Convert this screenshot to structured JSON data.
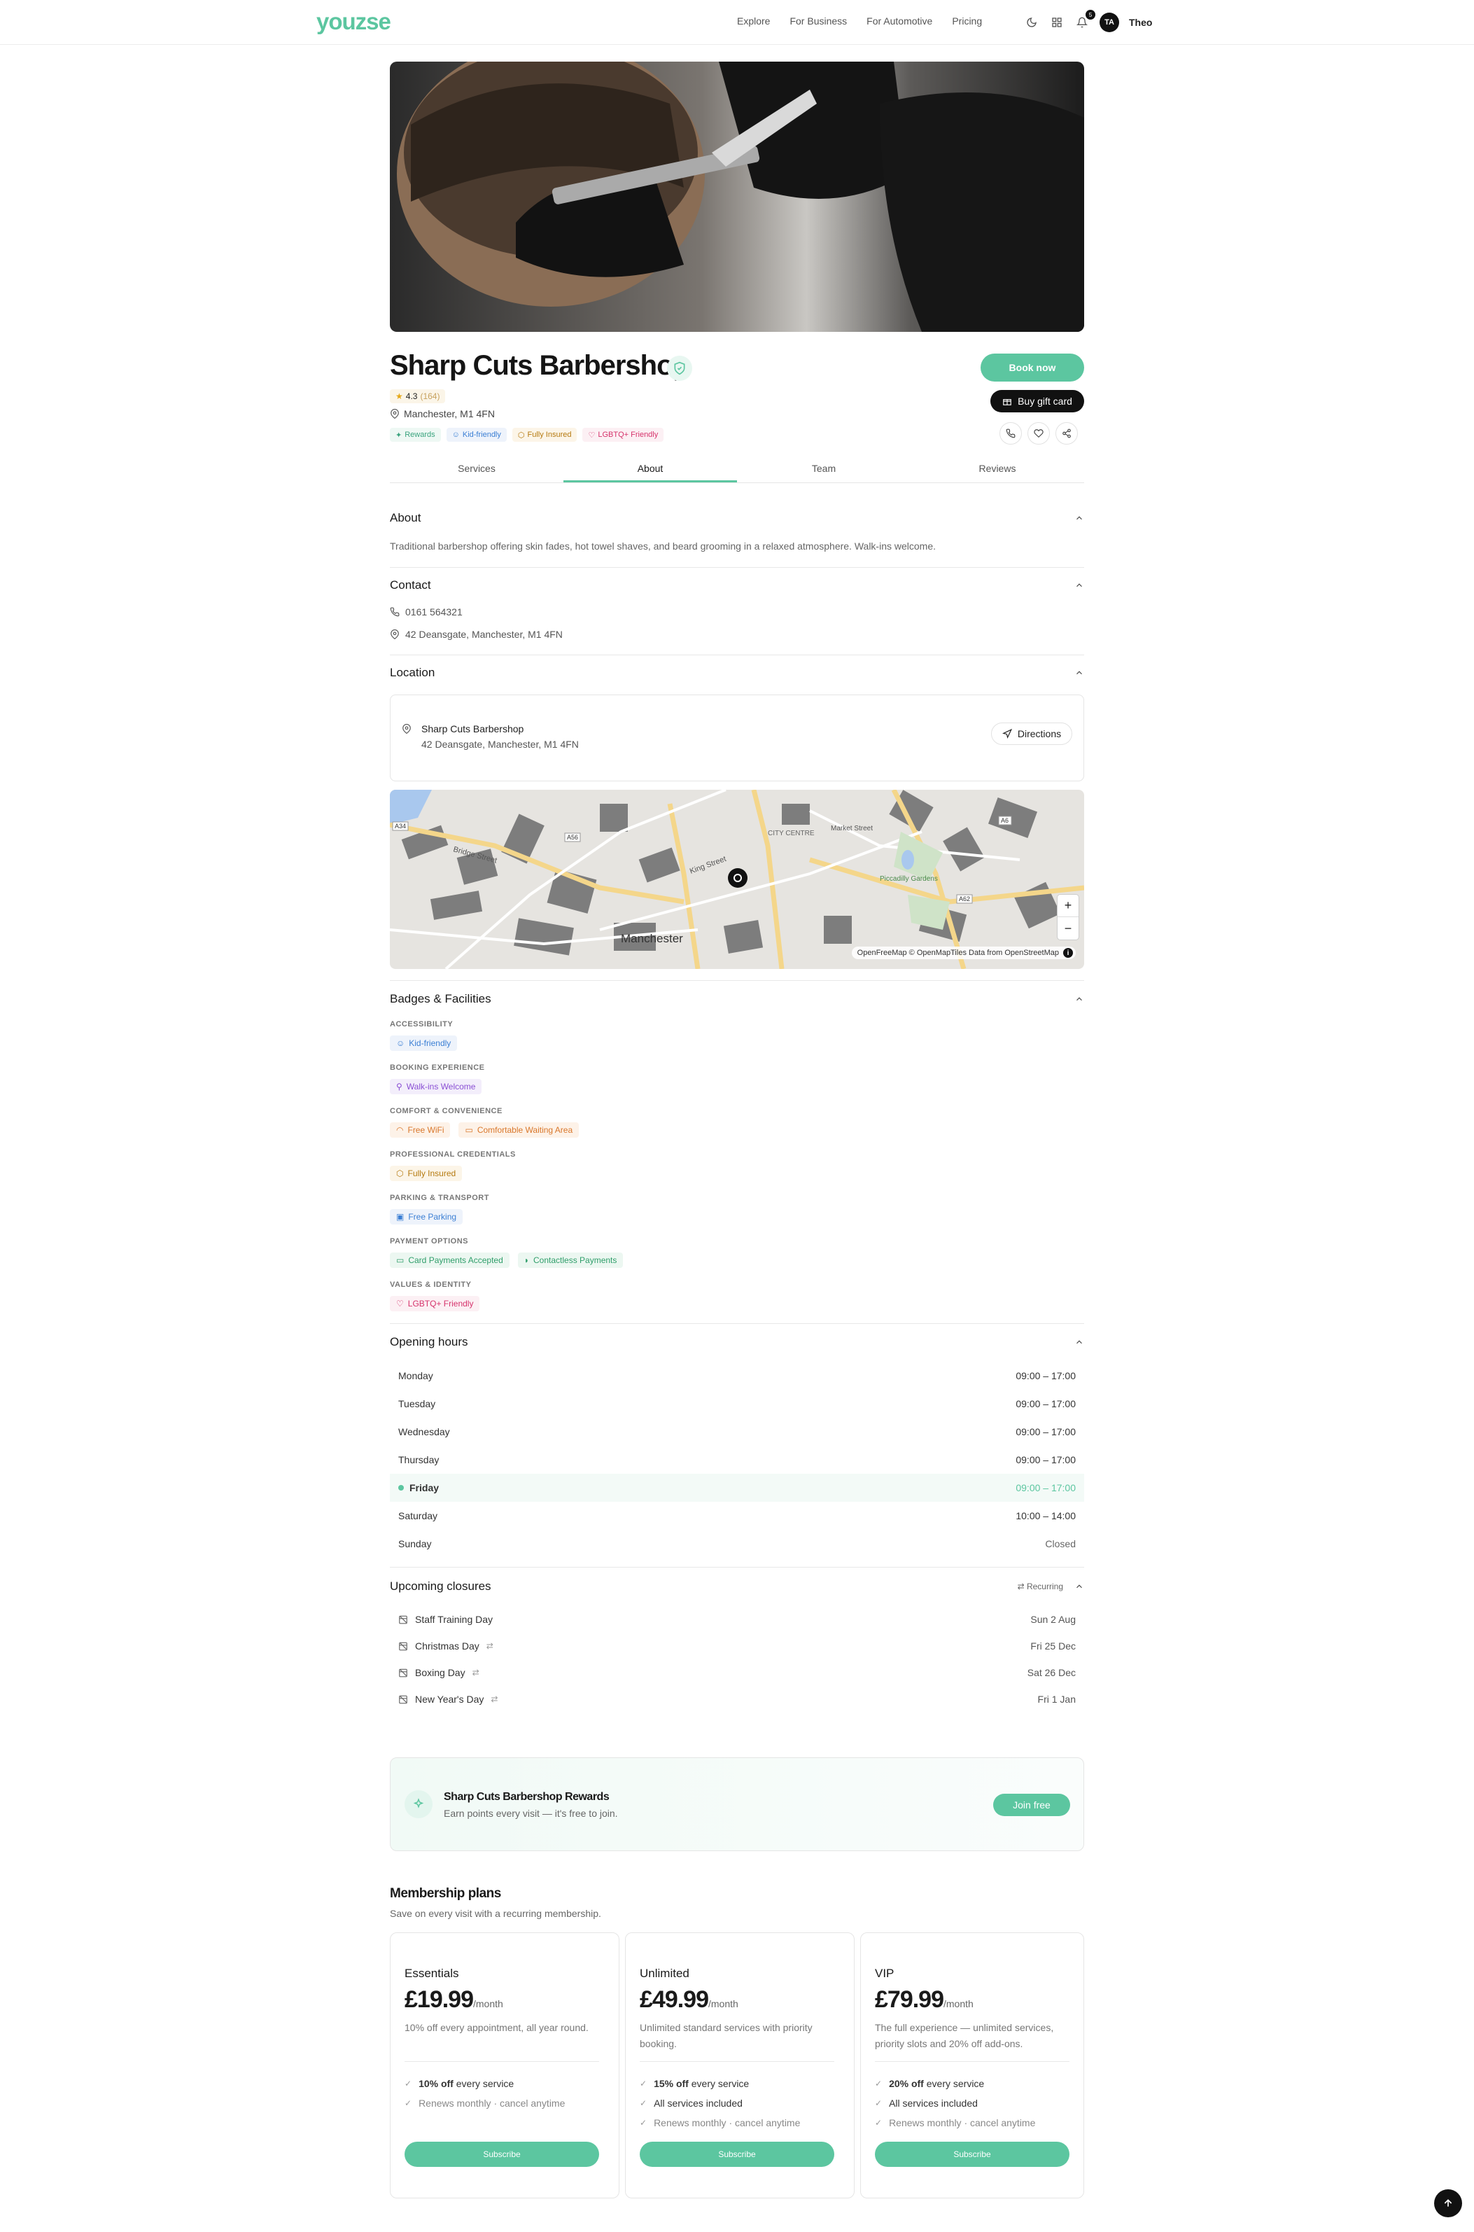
{
  "nav": {
    "logo": "youzse",
    "links": [
      "Explore",
      "For Business",
      "For Automotive",
      "Pricing"
    ],
    "notification_count": "5",
    "avatar_initials": "TA",
    "user_name": "Theo"
  },
  "business": {
    "name": "Sharp Cuts Barbershop",
    "rating": "4.3",
    "review_count": "(164)",
    "location": "Manchester, M1 4FN",
    "chips": [
      {
        "label": "Rewards",
        "color": "#5cc6a0"
      },
      {
        "label": "Kid-friendly",
        "color": "#3b7fd4"
      },
      {
        "label": "Fully Insured",
        "color": "#c98a1b"
      },
      {
        "label": "LGBTQ+ Friendly",
        "color": "#d6336c"
      }
    ]
  },
  "actions": {
    "book": "Book now",
    "gift": "Buy gift card"
  },
  "tabs": [
    "Services",
    "About",
    "Team",
    "Reviews"
  ],
  "active_tab": "About",
  "about": {
    "title": "About",
    "text": "Traditional barbershop offering skin fades, hot towel shaves, and beard grooming in a relaxed atmosphere. Walk-ins welcome."
  },
  "contact": {
    "title": "Contact",
    "phone": "0161 564321",
    "address": "42 Deansgate, Manchester, M1 4FN"
  },
  "location": {
    "title": "Location",
    "name": "Sharp Cuts Barbershop",
    "address": "42 Deansgate, Manchester, M1 4FN",
    "directions": "Directions",
    "map_labels": [
      "Manchester",
      "CITY CENTRE",
      "Piccadilly Gardens",
      "Market Street",
      "King Street",
      "Bridge Street",
      "A34",
      "A56",
      "A62",
      "A6"
    ],
    "attribution": "OpenFreeMap © OpenMapTiles Data from OpenStreetMap",
    "zoom_in": "+",
    "zoom_out": "−"
  },
  "badges": {
    "title": "Badges & Facilities",
    "groups": [
      {
        "label": "ACCESSIBILITY",
        "items": [
          {
            "name": "Kid-friendly",
            "color": "#3b7fd4"
          }
        ]
      },
      {
        "label": "BOOKING EXPERIENCE",
        "items": [
          {
            "name": "Walk-ins Welcome",
            "color": "#8a4fd4"
          }
        ]
      },
      {
        "label": "COMFORT & CONVENIENCE",
        "items": [
          {
            "name": "Free WiFi",
            "color": "#d9772b"
          },
          {
            "name": "Comfortable Waiting Area",
            "color": "#d9772b"
          }
        ]
      },
      {
        "label": "PROFESSIONAL CREDENTIALS",
        "items": [
          {
            "name": "Fully Insured",
            "color": "#c98a1b"
          }
        ]
      },
      {
        "label": "PARKING & TRANSPORT",
        "items": [
          {
            "name": "Free Parking",
            "color": "#3b7fd4"
          }
        ]
      },
      {
        "label": "PAYMENT OPTIONS",
        "items": [
          {
            "name": "Card Payments Accepted",
            "color": "#2f9e6a"
          },
          {
            "name": "Contactless Payments",
            "color": "#2f9e6a"
          }
        ]
      },
      {
        "label": "VALUES & IDENTITY",
        "items": [
          {
            "name": "LGBTQ+ Friendly",
            "color": "#d6336c"
          }
        ]
      }
    ]
  },
  "hours": {
    "title": "Opening hours",
    "days": [
      {
        "day": "Monday",
        "time": "09:00 – 17:00"
      },
      {
        "day": "Tuesday",
        "time": "09:00 – 17:00"
      },
      {
        "day": "Wednesday",
        "time": "09:00 – 17:00"
      },
      {
        "day": "Thursday",
        "time": "09:00 – 17:00"
      },
      {
        "day": "Friday",
        "time": "09:00 – 17:00"
      },
      {
        "day": "Saturday",
        "time": "10:00 – 14:00"
      },
      {
        "day": "Sunday",
        "time": "Closed"
      }
    ]
  },
  "closures": {
    "title": "Upcoming closures",
    "recurring_label": "Recurring",
    "items": [
      {
        "name": "Staff Training Day",
        "date": "Sun 2 Aug",
        "recurring": false
      },
      {
        "name": "Christmas Day",
        "date": "Fri 25 Dec",
        "recurring": true
      },
      {
        "name": "Boxing Day",
        "date": "Sat 26 Dec",
        "recurring": true
      },
      {
        "name": "New Year's Day",
        "date": "Fri 1 Jan",
        "recurring": true
      }
    ]
  },
  "rewards": {
    "title": "Sharp Cuts Barbershop Rewards",
    "subtitle": "Earn points every visit — it's free to join.",
    "button": "Join free"
  },
  "membership": {
    "title": "Membership plans",
    "subtitle": "Save on every visit with a recurring membership.",
    "plans": [
      {
        "name": "Essentials",
        "price": "£19.99",
        "period": "/month",
        "desc": "10% off every appointment, all year round.",
        "features": [
          {
            "b": "10% off",
            "t": " every service"
          },
          {
            "b": "",
            "t": "Renews monthly · cancel anytime"
          }
        ],
        "button": "Subscribe"
      },
      {
        "name": "Unlimited",
        "price": "£49.99",
        "period": "/month",
        "desc": "Unlimited standard services with priority booking.",
        "features": [
          {
            "b": "15% off",
            "t": " every service"
          },
          {
            "b": "",
            "t": "All services included"
          },
          {
            "b": "",
            "t": "Renews monthly · cancel anytime"
          }
        ],
        "button": "Subscribe"
      },
      {
        "name": "VIP",
        "price": "£79.99",
        "period": "/month",
        "desc": "The full experience — unlimited services, priority slots and 20% off add-ons.",
        "features": [
          {
            "b": "20% off",
            "t": " every service"
          },
          {
            "b": "",
            "t": "All services included"
          },
          {
            "b": "",
            "t": "Renews monthly · cancel anytime"
          }
        ],
        "button": "Subscribe"
      }
    ]
  },
  "colors": {
    "accent": "#5cc6a0",
    "dark": "#111111"
  }
}
